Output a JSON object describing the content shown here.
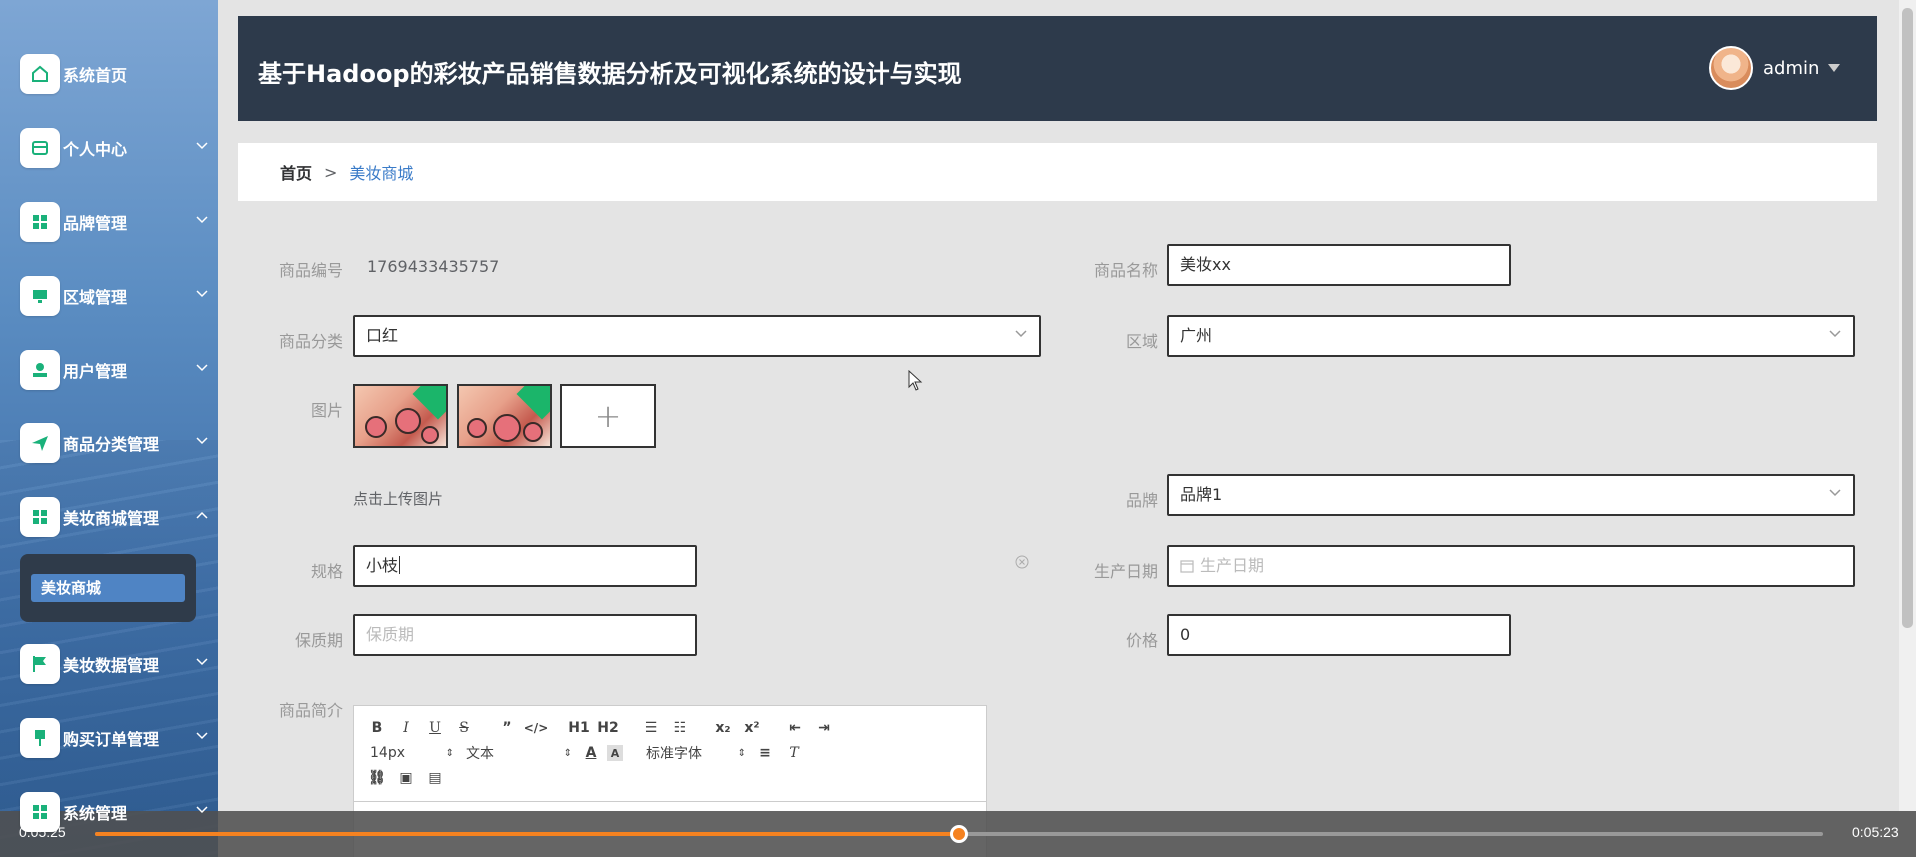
{
  "sidebar": {
    "items": [
      {
        "label": "系统首页",
        "icon": "home-icon",
        "chevron": false
      },
      {
        "label": "个人中心",
        "icon": "card-icon",
        "chevron": true
      },
      {
        "label": "品牌管理",
        "icon": "grid-icon",
        "chevron": true
      },
      {
        "label": "区域管理",
        "icon": "monitor-icon",
        "chevron": true
      },
      {
        "label": "用户管理",
        "icon": "user-icon",
        "chevron": true
      },
      {
        "label": "商品分类管理",
        "icon": "send-icon",
        "chevron": true
      },
      {
        "label": "美妆商城管理",
        "icon": "grid-icon",
        "chevron": true,
        "expanded": true
      },
      {
        "label": "美妆数据管理",
        "icon": "flag-icon",
        "chevron": true
      },
      {
        "label": "购买订单管理",
        "icon": "pin-icon",
        "chevron": true
      },
      {
        "label": "系统管理",
        "icon": "grid-icon",
        "chevron": true
      }
    ],
    "submenu": {
      "label": "美妆商城"
    },
    "accent_color": "#1ab17a"
  },
  "header": {
    "title": "基于Hadoop的彩妆产品销售数据分析及可视化系统的设计与实现",
    "user": "admin"
  },
  "breadcrumb": {
    "home": "首页",
    "separator": ">",
    "current": "美妆商城"
  },
  "form": {
    "product_no": {
      "label": "商品编号",
      "value": "1769433435757"
    },
    "product_name": {
      "label": "商品名称",
      "value": "美妆xx"
    },
    "category": {
      "label": "商品分类",
      "value": "口红"
    },
    "region": {
      "label": "区域",
      "value": "广州"
    },
    "images": {
      "label": "图片",
      "hint": "点击上传图片",
      "upload_symbol": "+"
    },
    "brand": {
      "label": "品牌",
      "value": "品牌1"
    },
    "spec": {
      "label": "规格",
      "value": "小枝"
    },
    "production_date": {
      "label": "生产日期",
      "placeholder": "生产日期"
    },
    "shelf_life": {
      "label": "保质期",
      "placeholder": "保质期"
    },
    "price": {
      "label": "价格",
      "value": "0"
    },
    "description": {
      "label": "商品简介"
    }
  },
  "editor": {
    "font_size": "14px",
    "block_type": "文本",
    "font_family": "标准字体",
    "h1": "H1",
    "h2": "H2",
    "subscript": "x₂",
    "superscript": "x²"
  },
  "video": {
    "current_time": "0:05:25",
    "total_time": "0:05:23",
    "progress": 0.5,
    "progress_color": "#f58220"
  }
}
